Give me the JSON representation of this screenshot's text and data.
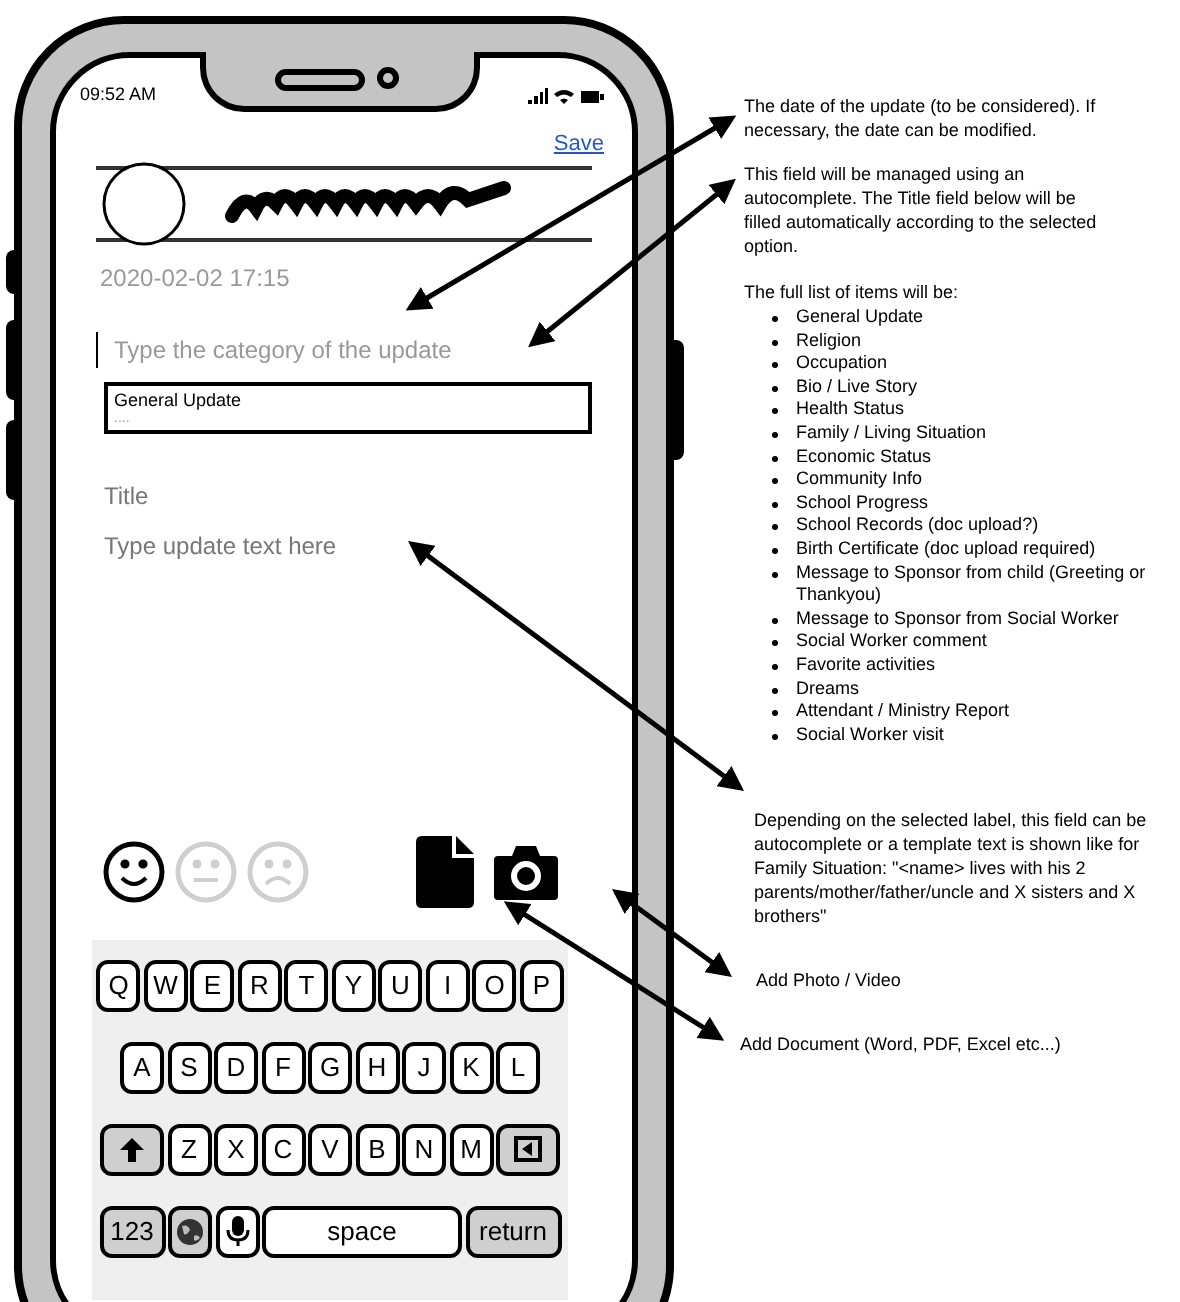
{
  "status_bar": {
    "time": "09:52 AM"
  },
  "save_link": "Save",
  "profile": {
    "date": "2020-02-02 17:15"
  },
  "category_field": {
    "placeholder": "Type the category of the update",
    "suggestions": [
      "General Update",
      "...."
    ]
  },
  "title_field": {
    "placeholder": "Title"
  },
  "text_field": {
    "placeholder": "Type update text here"
  },
  "moods": [
    {
      "kind": "happy",
      "selected": true
    },
    {
      "kind": "neutral",
      "selected": false
    },
    {
      "kind": "sad",
      "selected": false
    }
  ],
  "attachments": [
    {
      "kind": "document"
    },
    {
      "kind": "camera"
    }
  ],
  "keyboard": {
    "rows": [
      {
        "keys": [
          {
            "kind": "letter",
            "label": "Q"
          },
          {
            "kind": "letter",
            "label": "W"
          },
          {
            "kind": "letter",
            "label": "E"
          },
          {
            "kind": "letter",
            "label": "R"
          },
          {
            "kind": "letter",
            "label": "T"
          },
          {
            "kind": "letter",
            "label": "Y"
          },
          {
            "kind": "letter",
            "label": "U"
          },
          {
            "kind": "letter",
            "label": "I"
          },
          {
            "kind": "letter",
            "label": "O"
          },
          {
            "kind": "letter",
            "label": "P"
          }
        ]
      },
      {
        "keys": [
          {
            "kind": "letter",
            "label": "A"
          },
          {
            "kind": "letter",
            "label": "S"
          },
          {
            "kind": "letter",
            "label": "D"
          },
          {
            "kind": "letter",
            "label": "F"
          },
          {
            "kind": "letter",
            "label": "G"
          },
          {
            "kind": "letter",
            "label": "H"
          },
          {
            "kind": "letter",
            "label": "J"
          },
          {
            "kind": "letter",
            "label": "K"
          },
          {
            "kind": "letter",
            "label": "L"
          }
        ]
      },
      {
        "keys": [
          {
            "kind": "shift"
          },
          {
            "kind": "letter",
            "label": "Z"
          },
          {
            "kind": "letter",
            "label": "X"
          },
          {
            "kind": "letter",
            "label": "C"
          },
          {
            "kind": "letter",
            "label": "V"
          },
          {
            "kind": "letter",
            "label": "B"
          },
          {
            "kind": "letter",
            "label": "N"
          },
          {
            "kind": "letter",
            "label": "M"
          },
          {
            "kind": "backspace"
          }
        ]
      },
      {
        "keys": [
          {
            "kind": "numbers",
            "label": "123"
          },
          {
            "kind": "globe"
          },
          {
            "kind": "mic"
          },
          {
            "kind": "space",
            "label": "space"
          },
          {
            "kind": "return",
            "label": "return"
          }
        ]
      }
    ]
  },
  "notes": [
    {
      "text": "The date of the update (to be considered). If necessary, the date can be modified."
    },
    {
      "text": "This field will be managed using an autocomplete. The Title field below will be filled automatically according to the selected option."
    },
    {
      "text": "The full list of items will be:",
      "items": [
        "General Update",
        "Religion",
        "Occupation",
        "Bio / Live Story",
        "Health Status",
        "Family / Living Situation",
        "Economic Status",
        "Community Info",
        "School Progress",
        "School Records (doc upload?)",
        "Birth Certificate (doc upload required)",
        "Message to Sponsor from child (Greeting or Thankyou)",
        "Message to Sponsor from Social Worker",
        "Social Worker comment",
        "Favorite activities",
        "Dreams",
        "Attendant / Ministry Report",
        "Social Worker visit"
      ]
    },
    {
      "text": "Depending on the selected label, this field can be autocomplete or a template text is shown like for Family Situation: \"<name> lives with his 2 parents/mother/father/uncle and X sisters and X brothers\""
    },
    {
      "text": "Add Photo / Video"
    },
    {
      "text": "Add Document (Word, PDF, Excel etc...)"
    }
  ]
}
